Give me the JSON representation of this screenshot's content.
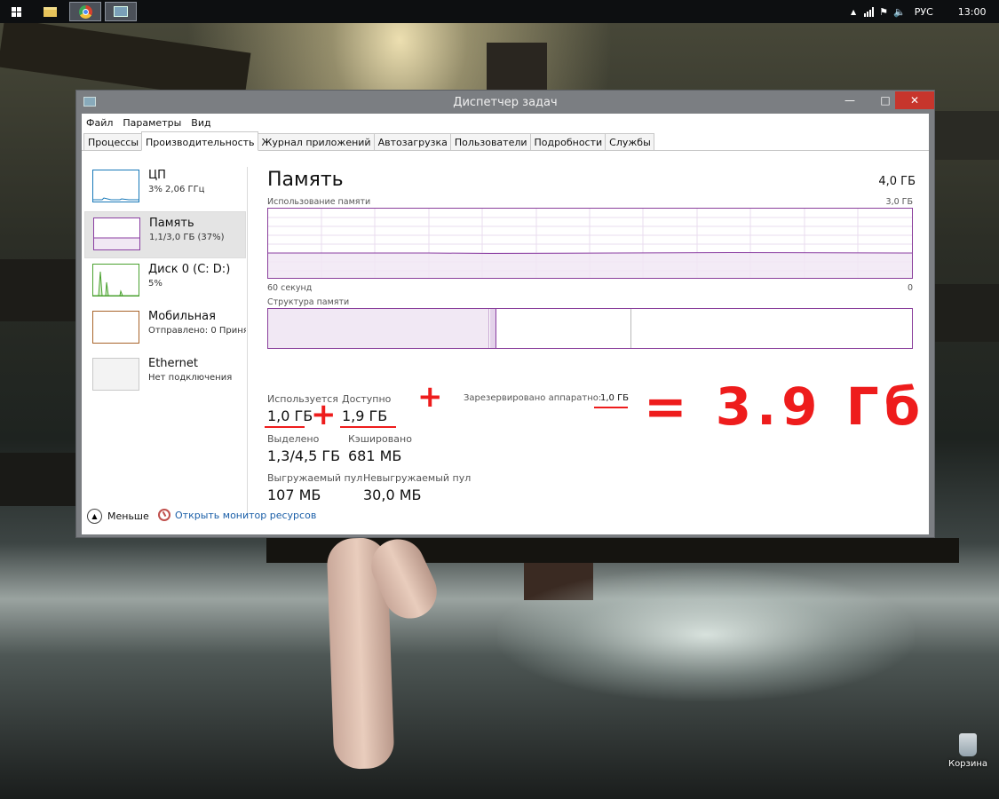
{
  "taskbar": {
    "lang": "РУС",
    "clock": "13:00",
    "colors": {
      "bar": "#0d0f11"
    }
  },
  "window": {
    "title": "Диспетчер задач",
    "controls": {
      "minimize": "—",
      "maximize": "□",
      "close": "✕"
    }
  },
  "menu": [
    "Файл",
    "Параметры",
    "Вид"
  ],
  "tabs": [
    "Процессы",
    "Производительность",
    "Журнал приложений",
    "Автозагрузка",
    "Пользователи",
    "Подробности",
    "Службы"
  ],
  "sidebar": {
    "items": [
      {
        "name": "ЦП",
        "sub": "3% 2,06 ГГц",
        "color": "#1778b8"
      },
      {
        "name": "Память",
        "sub": "1,1/3,0 ГБ (37%)",
        "color": "#8b3fa2"
      },
      {
        "name": "Диск 0 (C: D:)",
        "sub": "5%",
        "color": "#4aa12f"
      },
      {
        "name": "Мобильная",
        "sub": "Отправлено: 0 Принят",
        "color": "#a8642a"
      },
      {
        "name": "Ethernet",
        "sub": "Нет подключения",
        "color": "#c8c8c8"
      }
    ]
  },
  "panel": {
    "title": "Память",
    "total": "4,0 ГБ",
    "usage_label": "Использование памяти",
    "usage_max": "3,0 ГБ",
    "axis_left": "60 секунд",
    "axis_right": "0",
    "structure_label": "Структура памяти",
    "stats": {
      "in_use_label": "Используется",
      "in_use": "1,0 ГБ",
      "available_label": "Доступно",
      "available": "1,9 ГБ",
      "reserved_label": "Зарезервировано аппаратно:",
      "reserved": "1,0 ГБ",
      "committed_label": "Выделено",
      "committed": "1,3/4,5 ГБ",
      "cached_label": "Кэшировано",
      "cached": "681 МБ",
      "paged_label": "Выгружаемый пул",
      "paged": "107 МБ",
      "nonpaged_label": "Невыгружаемый пул",
      "nonpaged": "30,0 МБ"
    },
    "colors": {
      "accent": "#8b3fa2"
    }
  },
  "annotations": {
    "plus": "+",
    "result": "= 3.9 Гб",
    "color": "#ee1c1c"
  },
  "footer": {
    "fewer": "Меньше",
    "monitor_link": "Открыть монитор ресурсов"
  },
  "desktop": {
    "recycle_bin": "Корзина"
  }
}
